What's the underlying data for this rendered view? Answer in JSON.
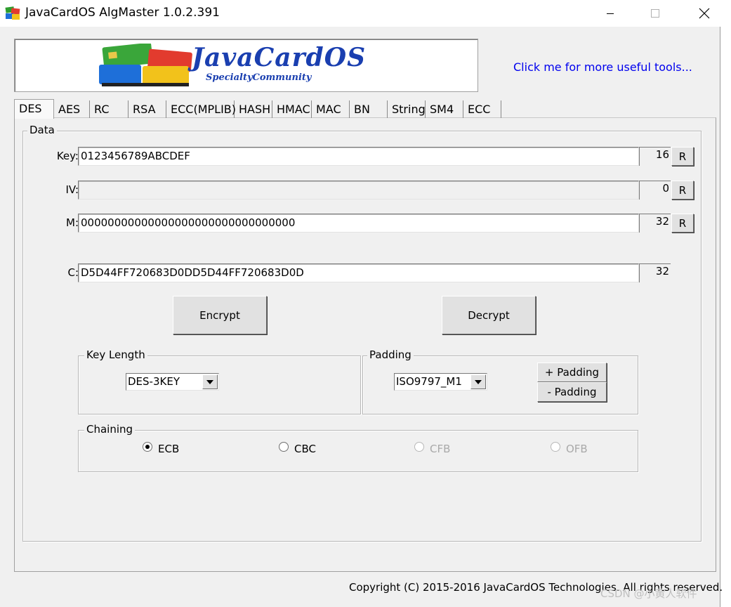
{
  "window": {
    "title": "JavaCardOS AlgMaster 1.0.2.391",
    "buttons": {
      "minimize_icon": "minimize-icon",
      "maximize_icon": "maximize-icon",
      "close_icon": "close-icon"
    }
  },
  "banner": {
    "logo_title": "JavaCardOS",
    "logo_subtitle": "SpecialtyCommunity",
    "link_text": "Click me for more useful tools..."
  },
  "tabs": [
    {
      "label": "DES",
      "active": true
    },
    {
      "label": "AES"
    },
    {
      "label": "RC"
    },
    {
      "label": "RSA"
    },
    {
      "label": "ECC(MPLIB)"
    },
    {
      "label": "HASH"
    },
    {
      "label": "HMAC"
    },
    {
      "label": "MAC"
    },
    {
      "label": "BN"
    },
    {
      "label": "String"
    },
    {
      "label": "SM4"
    },
    {
      "label": "ECC"
    }
  ],
  "data_group": {
    "label": "Data",
    "key": {
      "label": "Key:",
      "value": "0123456789ABCDEF",
      "length": "16",
      "button": "R"
    },
    "iv": {
      "label": "IV:",
      "value": "",
      "length": "0",
      "button": "R"
    },
    "m": {
      "label": "M:",
      "value": "00000000000000000000000000000000",
      "length": "32",
      "button": "R"
    },
    "c": {
      "label": "C:",
      "value": "D5D44FF720683D0DD5D44FF720683D0D",
      "length": "32"
    },
    "encrypt_label": "Encrypt",
    "decrypt_label": "Decrypt"
  },
  "key_length": {
    "label": "Key Length",
    "selected": "DES-3KEY"
  },
  "padding": {
    "label": "Padding",
    "selected": "ISO9797_M1",
    "add_label": "+ Padding",
    "remove_label": "- Padding"
  },
  "chaining": {
    "label": "Chaining",
    "options": [
      {
        "label": "ECB",
        "checked": true,
        "enabled": true
      },
      {
        "label": "CBC",
        "checked": false,
        "enabled": true
      },
      {
        "label": "CFB",
        "checked": false,
        "enabled": false
      },
      {
        "label": "OFB",
        "checked": false,
        "enabled": false
      }
    ]
  },
  "footer": {
    "copyright": "Copyright (C) 2015-2016 JavaCardOS Technologies. All rights reserved.",
    "watermark": "CSDN @小黄人软件"
  },
  "colors": {
    "link": "#0000ee",
    "logo_blue": "#1a3fb0",
    "window_bg": "#f0f0f0"
  }
}
